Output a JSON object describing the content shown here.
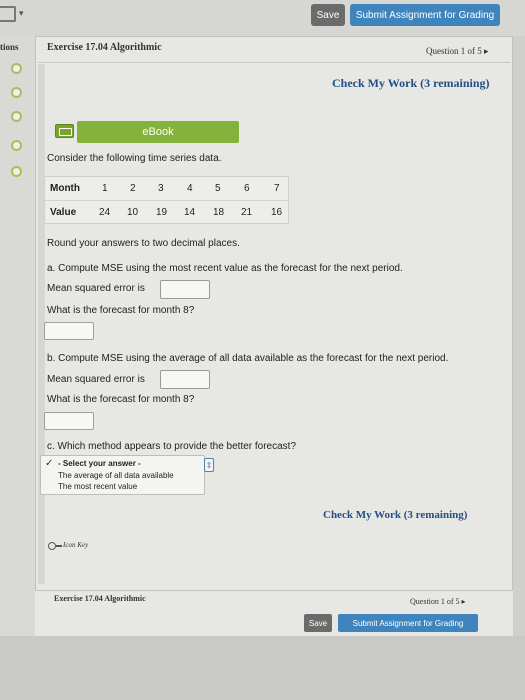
{
  "toolbar": {
    "save_label": "Save",
    "submit_label": "Submit Assignment for Grading"
  },
  "left_panel": {
    "title_fragment": "tions"
  },
  "header": {
    "exercise_title": "Exercise 17.04 Algorithmic",
    "question_nav": "Question 1 of 5 ▸"
  },
  "check_my_work": "Check My Work (3 remaining)",
  "ebook": {
    "label": "eBook"
  },
  "problem": {
    "intro": "Consider the following time series data.",
    "table": {
      "row_headers": [
        "Month",
        "Value"
      ],
      "months": [
        "1",
        "2",
        "3",
        "4",
        "5",
        "6",
        "7"
      ],
      "values": [
        "24",
        "10",
        "19",
        "14",
        "18",
        "21",
        "16"
      ]
    },
    "round_note": "Round your answers to two decimal places.",
    "part_a": {
      "prompt": "a. Compute MSE using the most recent value as the forecast for the next period.",
      "mse_label": "Mean squared error is",
      "forecast_label": "What is the forecast for month 8?"
    },
    "part_b": {
      "prompt": "b. Compute MSE using the average of all data available as the forecast for the next period.",
      "mse_label": "Mean squared error is",
      "forecast_label": "What is the forecast for month 8?"
    },
    "part_c": {
      "prompt": "c. Which method appears to provide the better forecast?",
      "options": [
        "- Select your answer -",
        "The average of all data available",
        "The most recent value"
      ]
    }
  },
  "icon_key_label": "Icon Key",
  "footer": {
    "exercise_title": "Exercise 17.04 Algorithmic",
    "question_nav": "Question 1 of 5 ▸",
    "save_label": "Save",
    "submit_label": "Submit Assignment for Grading"
  },
  "colors": {
    "accent_blue": "#3f84bd",
    "ebook_green": "#84b23b",
    "link_blue": "#244f86"
  }
}
